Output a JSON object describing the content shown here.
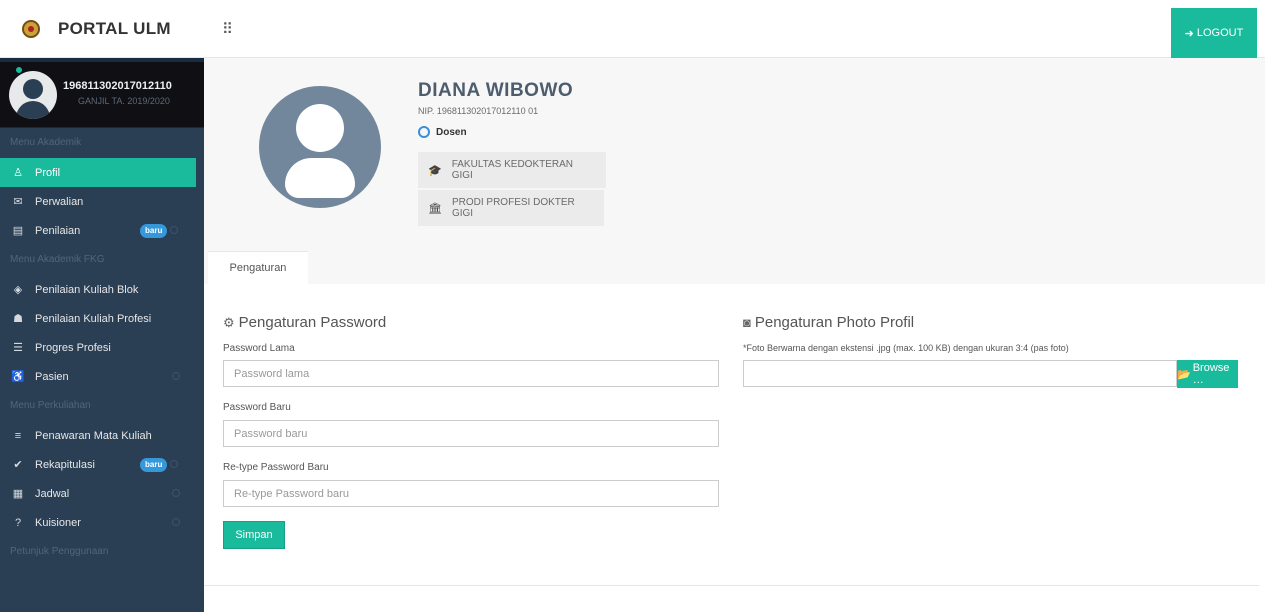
{
  "brand": {
    "title": "PORTAL ULM"
  },
  "topbar": {
    "logout_label": "LOGOUT"
  },
  "sidebar": {
    "profile": {
      "nip": "196811302017012110",
      "semester": "GANJIL TA. 2019/2020"
    },
    "sections": {
      "akademik": "Menu Akademik",
      "fkg": "Menu Akademik FKG",
      "perkuliahan": "Menu Perkuliahan",
      "petunjuk": "Petunjuk Penggunaan"
    },
    "items": [
      {
        "label": "Profil",
        "icon": "user-icon"
      },
      {
        "label": "Perwalian",
        "icon": "chat-icon"
      },
      {
        "label": "Penilaian",
        "icon": "document-icon",
        "badge": "baru"
      },
      {
        "label": "Penilaian Kuliah Blok",
        "icon": "shield-icon"
      },
      {
        "label": "Penilaian Kuliah Profesi",
        "icon": "group-icon"
      },
      {
        "label": "Progres Profesi",
        "icon": "list-icon"
      },
      {
        "label": "Pasien",
        "icon": "person-icon"
      },
      {
        "label": "Penawaran Mata Kuliah",
        "icon": "menu-icon"
      },
      {
        "label": "Rekapitulasi",
        "icon": "check-icon",
        "badge": "baru"
      },
      {
        "label": "Jadwal",
        "icon": "calendar-icon"
      },
      {
        "label": "Kuisioner",
        "icon": "question-icon"
      }
    ]
  },
  "profile_header": {
    "name": "DIANA WIBOWO",
    "nip": "NIP. 196811302017012110 01",
    "role": "Dosen",
    "faculty": "FAKULTAS KEDOKTERAN GIGI",
    "program": "PRODI PROFESI DOKTER GIGI"
  },
  "tabs": {
    "settings": "Pengaturan"
  },
  "password_section": {
    "title": "Pengaturan Password",
    "old_label": "Password Lama",
    "old_placeholder": "Password lama",
    "new_label": "Password Baru",
    "new_placeholder": "Password baru",
    "retype_label": "Re-type Password Baru",
    "retype_placeholder": "Re-type Password baru",
    "save_label": "Simpan"
  },
  "photo_section": {
    "title": "Pengaturan Photo Profil",
    "hint": "*Foto Berwarna dengan ekstensi .jpg (max. 100 KB) dengan ukuran 3:4 (pas foto)",
    "browse_label": "Browse …"
  },
  "colors": {
    "accent": "#1abb9c",
    "sidebar": "#2a3f54",
    "badge": "#3498db"
  }
}
